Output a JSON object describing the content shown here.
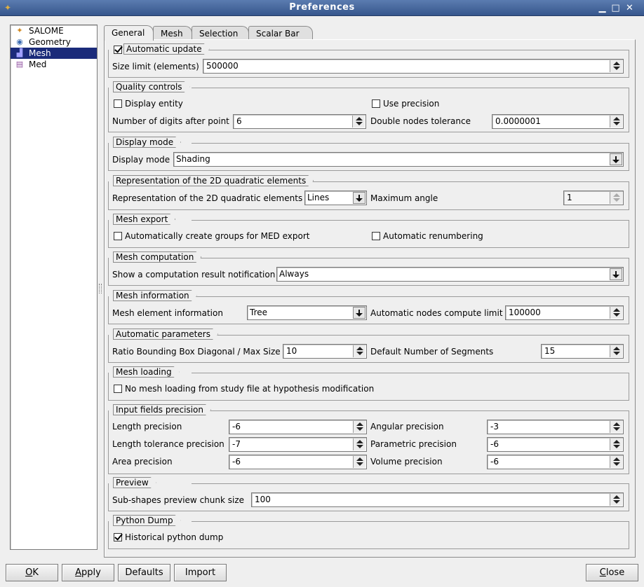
{
  "window": {
    "title": "Preferences",
    "minimize": "▁",
    "maximize": "□",
    "close": "✕"
  },
  "tree": [
    {
      "label": "SALOME",
      "icon": "salome-icon",
      "glyph": "✦",
      "color": "#d08820"
    },
    {
      "label": "Geometry",
      "icon": "geometry-icon",
      "glyph": "◉",
      "color": "#3a6ab0"
    },
    {
      "label": "Mesh",
      "icon": "mesh-icon",
      "glyph": "▟",
      "color": "#7070c0",
      "selected": true
    },
    {
      "label": "Med",
      "icon": "med-icon",
      "glyph": "▤",
      "color": "#9050a0"
    }
  ],
  "tabs": [
    "General",
    "Mesh",
    "Selection",
    "Scalar Bar"
  ],
  "groups": {
    "automatic_update": {
      "title": "Automatic update",
      "checked": true,
      "size_limit_label": "Size limit (elements)",
      "size_limit_value": "500000"
    },
    "quality": {
      "title": "Quality controls",
      "display_entity": "Display entity",
      "use_precision": "Use precision",
      "digits_label": "Number of digits after point",
      "digits_value": "6",
      "tolerance_label": "Double nodes tolerance",
      "tolerance_value": "0.0000001"
    },
    "display_mode": {
      "title": "Display mode",
      "label": "Display mode",
      "value": "Shading"
    },
    "quadratic": {
      "title": "Representation of the 2D quadratic elements",
      "label": "Representation of the 2D quadratic elements",
      "value": "Lines",
      "max_angle_label": "Maximum angle",
      "max_angle_value": "1"
    },
    "export": {
      "title": "Mesh export",
      "groups_label": "Automatically create groups for MED export",
      "renumber_label": "Automatic renumbering"
    },
    "computation": {
      "title": "Mesh computation",
      "label": "Show a computation result notification",
      "value": "Always"
    },
    "information": {
      "title": "Mesh information",
      "label": "Mesh element information",
      "value": "Tree",
      "limit_label": "Automatic nodes compute limit",
      "limit_value": "100000"
    },
    "auto_params": {
      "title": "Automatic parameters",
      "ratio_label": "Ratio Bounding Box Diagonal / Max Size",
      "ratio_value": "10",
      "segments_label": "Default Number of Segments",
      "segments_value": "15"
    },
    "loading": {
      "title": "Mesh loading",
      "label": "No mesh loading from study file at hypothesis modification"
    },
    "precision": {
      "title": "Input fields precision",
      "length_label": "Length precision",
      "length_value": "-6",
      "angular_label": "Angular precision",
      "angular_value": "-3",
      "length_tol_label": "Length tolerance precision",
      "length_tol_value": "-7",
      "parametric_label": "Parametric precision",
      "parametric_value": "-6",
      "area_label": "Area precision",
      "area_value": "-6",
      "volume_label": "Volume precision",
      "volume_value": "-6"
    },
    "preview": {
      "title": "Preview",
      "label": "Sub-shapes preview chunk size",
      "value": "100"
    },
    "python": {
      "title": "Python Dump",
      "label": "Historical python dump",
      "checked": true
    }
  },
  "buttons": {
    "ok_u": "O",
    "ok_rest": "K",
    "apply_u": "A",
    "apply_rest": "pply",
    "defaults": "Defaults",
    "import": "Import",
    "close_u": "C",
    "close_rest": "lose"
  }
}
